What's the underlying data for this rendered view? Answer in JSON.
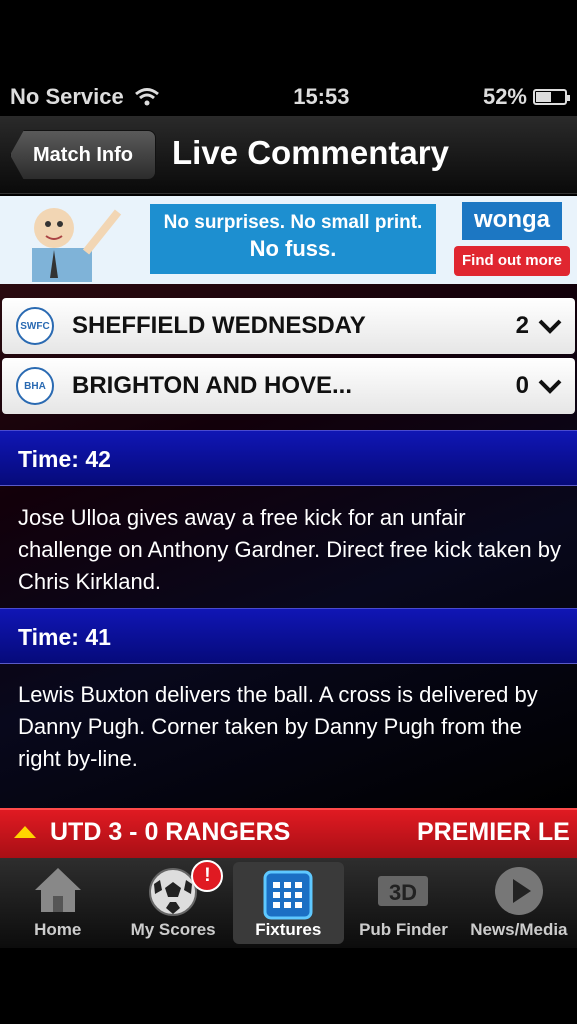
{
  "status": {
    "carrier": "No Service",
    "time": "15:53",
    "battery": "52%"
  },
  "nav": {
    "back_label": "Match Info",
    "title": "Live Commentary"
  },
  "ad": {
    "line1": "No surprises. No small print.",
    "line2": "No fuss.",
    "brand": "wonga",
    "cta": "Find out more"
  },
  "teams": [
    {
      "name": "SHEFFIELD WEDNESDAY",
      "score": "2",
      "crest": "SWFC"
    },
    {
      "name": "BRIGHTON AND HOVE...",
      "score": "0",
      "crest": "BHA"
    }
  ],
  "commentary": [
    {
      "time_label": "Time: 42",
      "text": "Jose Ulloa gives away a free kick for an unfair challenge on Anthony Gardner. Direct free kick taken by Chris Kirkland."
    },
    {
      "time_label": "Time: 41",
      "text": "Lewis Buxton delivers the ball. A cross is delivered by Danny Pugh. Corner taken by Danny Pugh from the right by-line."
    }
  ],
  "ticker": {
    "text": "UTD  3 - 0  RANGERS",
    "text2": "PREMIER LE"
  },
  "tabs": [
    {
      "label": "Home",
      "icon": "house-icon"
    },
    {
      "label": "My Scores",
      "icon": "football-icon",
      "badge": "!"
    },
    {
      "label": "Fixtures",
      "icon": "grid-icon",
      "active": true
    },
    {
      "label": "Pub Finder",
      "icon": "3d-icon"
    },
    {
      "label": "News/Media",
      "icon": "play-icon"
    }
  ],
  "colors": {
    "accent_red": "#e01a22",
    "time_bar_blue": "#1016b5",
    "ad_blue": "#1d8fd0"
  }
}
